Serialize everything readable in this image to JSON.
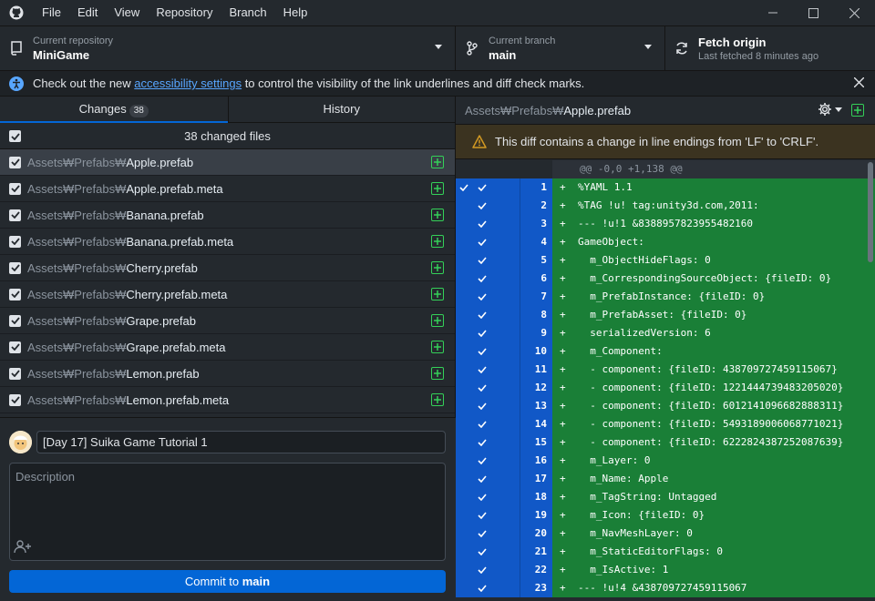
{
  "menu": [
    "File",
    "Edit",
    "View",
    "Repository",
    "Branch",
    "Help"
  ],
  "toolbar": {
    "repo_label": "Current repository",
    "repo_value": "MiniGame",
    "branch_label": "Current branch",
    "branch_value": "main",
    "fetch_label": "Fetch origin",
    "fetch_sub": "Last fetched 8 minutes ago"
  },
  "banner": {
    "before": "Check out the new ",
    "link": "accessibility settings",
    "after": " to control the visibility of the link underlines and diff check marks."
  },
  "tabs": {
    "changes_label": "Changes",
    "changes_count": "38",
    "history_label": "History"
  },
  "files_header": "38 changed files",
  "files": [
    {
      "dir": "Assets₩Prefabs₩",
      "name": "Apple.prefab"
    },
    {
      "dir": "Assets₩Prefabs₩",
      "name": "Apple.prefab.meta"
    },
    {
      "dir": "Assets₩Prefabs₩",
      "name": "Banana.prefab"
    },
    {
      "dir": "Assets₩Prefabs₩",
      "name": "Banana.prefab.meta"
    },
    {
      "dir": "Assets₩Prefabs₩",
      "name": "Cherry.prefab"
    },
    {
      "dir": "Assets₩Prefabs₩",
      "name": "Cherry.prefab.meta"
    },
    {
      "dir": "Assets₩Prefabs₩",
      "name": "Grape.prefab"
    },
    {
      "dir": "Assets₩Prefabs₩",
      "name": "Grape.prefab.meta"
    },
    {
      "dir": "Assets₩Prefabs₩",
      "name": "Lemon.prefab"
    },
    {
      "dir": "Assets₩Prefabs₩",
      "name": "Lemon.prefab.meta"
    }
  ],
  "commit": {
    "summary": "[Day 17] Suika Game Tutorial 1",
    "description_placeholder": "Description",
    "button_prefix": "Commit to ",
    "button_branch": "main"
  },
  "diff": {
    "path_dir": "Assets₩Prefabs₩",
    "path_name": "Apple.prefab",
    "warning": "This diff contains a change in line endings from 'LF' to 'CRLF'.",
    "hunk": "@@ -0,0 +1,138 @@",
    "lines": [
      {
        "n": "1",
        "t": "%YAML 1.1"
      },
      {
        "n": "2",
        "t": "%TAG !u! tag:unity3d.com,2011:"
      },
      {
        "n": "3",
        "t": "--- !u!1 &8388957823955482160"
      },
      {
        "n": "4",
        "t": "GameObject:"
      },
      {
        "n": "5",
        "t": "  m_ObjectHideFlags: 0"
      },
      {
        "n": "6",
        "t": "  m_CorrespondingSourceObject: {fileID: 0}"
      },
      {
        "n": "7",
        "t": "  m_PrefabInstance: {fileID: 0}"
      },
      {
        "n": "8",
        "t": "  m_PrefabAsset: {fileID: 0}"
      },
      {
        "n": "9",
        "t": "  serializedVersion: 6"
      },
      {
        "n": "10",
        "t": "  m_Component:"
      },
      {
        "n": "11",
        "t": "  - component: {fileID: 438709727459115067}"
      },
      {
        "n": "12",
        "t": "  - component: {fileID: 1221444739483205020}"
      },
      {
        "n": "13",
        "t": "  - component: {fileID: 6012141096682888311}"
      },
      {
        "n": "14",
        "t": "  - component: {fileID: 5493189006068771021}"
      },
      {
        "n": "15",
        "t": "  - component: {fileID: 6222824387252087639}"
      },
      {
        "n": "16",
        "t": "  m_Layer: 0"
      },
      {
        "n": "17",
        "t": "  m_Name: Apple"
      },
      {
        "n": "18",
        "t": "  m_TagString: Untagged"
      },
      {
        "n": "19",
        "t": "  m_Icon: {fileID: 0}"
      },
      {
        "n": "20",
        "t": "  m_NavMeshLayer: 0"
      },
      {
        "n": "21",
        "t": "  m_StaticEditorFlags: 0"
      },
      {
        "n": "22",
        "t": "  m_IsActive: 1"
      },
      {
        "n": "23",
        "t": "--- !u!4 &438709727459115067"
      }
    ]
  }
}
